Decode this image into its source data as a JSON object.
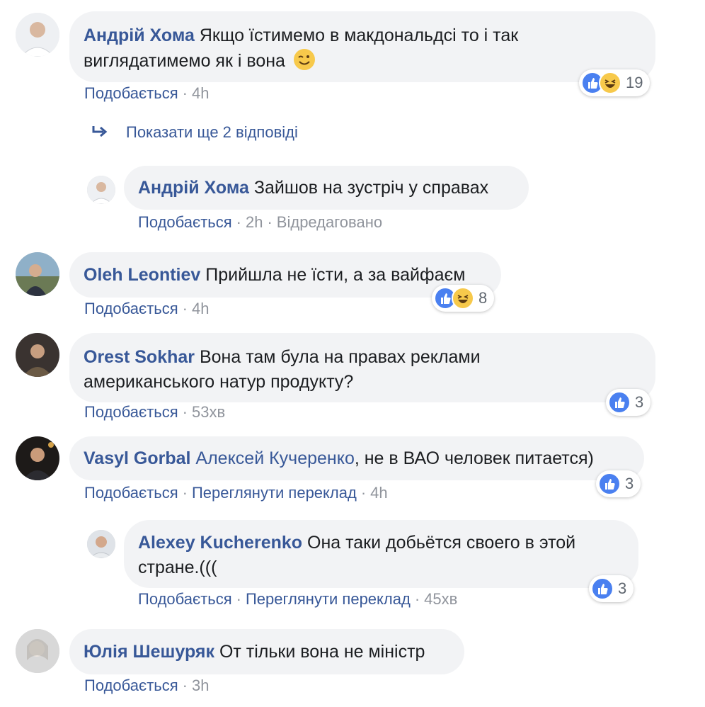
{
  "comments": [
    {
      "author": "Андрій Хома",
      "text": "Якщо їстимемо в макдональдсі то і так",
      "text2": "виглядатимемо як і вона",
      "emoji": "wink-emoji",
      "like_label": "Подобається",
      "time": "4h",
      "reactions": [
        "like-icon",
        "haha-icon"
      ],
      "reaction_count": "19"
    },
    {
      "show_more": "Показати ще 2 відповіді",
      "show_more_icon": "reply-arrow-icon"
    },
    {
      "author": "Андрій Хома",
      "text": "Зайшов на зустріч у справах",
      "like_label": "Подобається",
      "time": "2h",
      "edited": "Відредаговано"
    },
    {
      "author": "Oleh Leontiev",
      "text": "Прийшла не їсти, а за вайфаєм",
      "like_label": "Подобається",
      "time": "4h",
      "reactions": [
        "like-icon",
        "haha-icon"
      ],
      "reaction_count": "8"
    },
    {
      "author": "Orest Sokhar",
      "text": "Вона там була на правах реклами",
      "text2": "американського натур продукту?",
      "like_label": "Подобається",
      "time": "53хв",
      "reactions": [
        "like-icon"
      ],
      "reaction_count": "3"
    },
    {
      "author": "Vasyl Gorbal",
      "mention": "Алексей Кучеренко",
      "text": ", не в ВАО человек питается)",
      "like_label": "Подобається",
      "translate_label": "Переглянути переклад",
      "time": "4h",
      "reactions": [
        "like-icon"
      ],
      "reaction_count": "3"
    },
    {
      "author": "Alexey Kucherenko",
      "text": "Она таки добьётся своего в этой",
      "text2": "стране.(((",
      "like_label": "Подобається",
      "translate_label": "Переглянути переклад",
      "time": "45хв",
      "reactions": [
        "like-icon"
      ],
      "reaction_count": "3"
    },
    {
      "author": "Юлія Шешуряк",
      "text": "От тільки вона не міністр",
      "like_label": "Подобається",
      "time": "3h"
    }
  ],
  "colors": {
    "link": "#385898",
    "bubble": "#f2f3f5",
    "meta": "#90949c",
    "like": "#4a80f0",
    "haha": "#f7c94b"
  }
}
